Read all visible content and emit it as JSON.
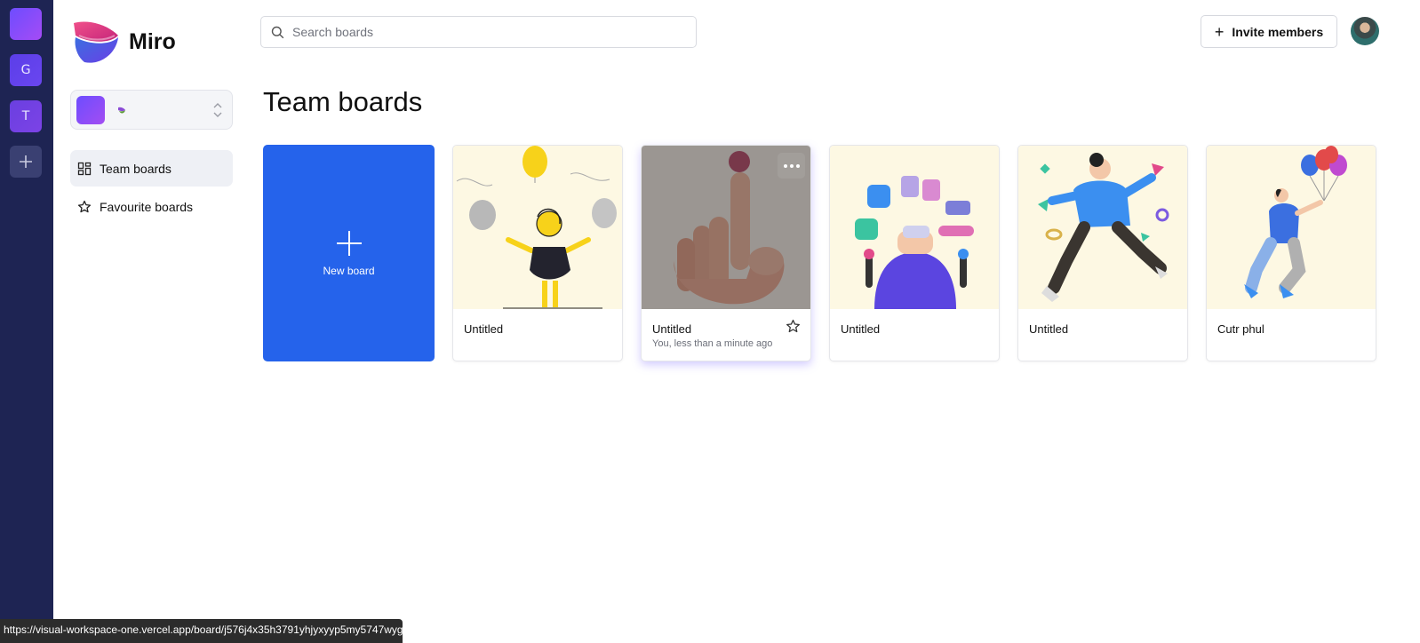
{
  "rail": {
    "orgs": [
      {
        "initial": ""
      },
      {
        "initial": "G"
      },
      {
        "initial": "T"
      }
    ],
    "add_label": "+"
  },
  "app": {
    "title": "Miro"
  },
  "sidebar": {
    "items": [
      {
        "label": "Team boards",
        "icon": "grid-icon",
        "active": true
      },
      {
        "label": "Favourite boards",
        "icon": "star-icon",
        "active": false
      }
    ]
  },
  "search": {
    "placeholder": "Search boards",
    "value": ""
  },
  "header": {
    "invite_label": "Invite members"
  },
  "main": {
    "title": "Team boards",
    "new_board_label": "New board",
    "boards": [
      {
        "title": "Untitled",
        "subtitle": "",
        "illustration": "person-with-balloons"
      },
      {
        "title": "Untitled",
        "subtitle": "You, less than a minute ago",
        "illustration": "finger-balancing-ball"
      },
      {
        "title": "Untitled",
        "subtitle": "",
        "illustration": "vr-person-with-apps"
      },
      {
        "title": "Untitled",
        "subtitle": "",
        "illustration": "person-jumping"
      },
      {
        "title": "Cutr phul",
        "subtitle": "",
        "illustration": "person-floating-with-balloons"
      }
    ]
  },
  "status_bar": {
    "url": "https://visual-workspace-one.vercel.app/board/j576j4x35h3791yhjyxyyp5my5747wyg"
  },
  "colors": {
    "rail": "#1e2453",
    "accent": "#2563eb",
    "card_bg": "#fdf8e3"
  }
}
